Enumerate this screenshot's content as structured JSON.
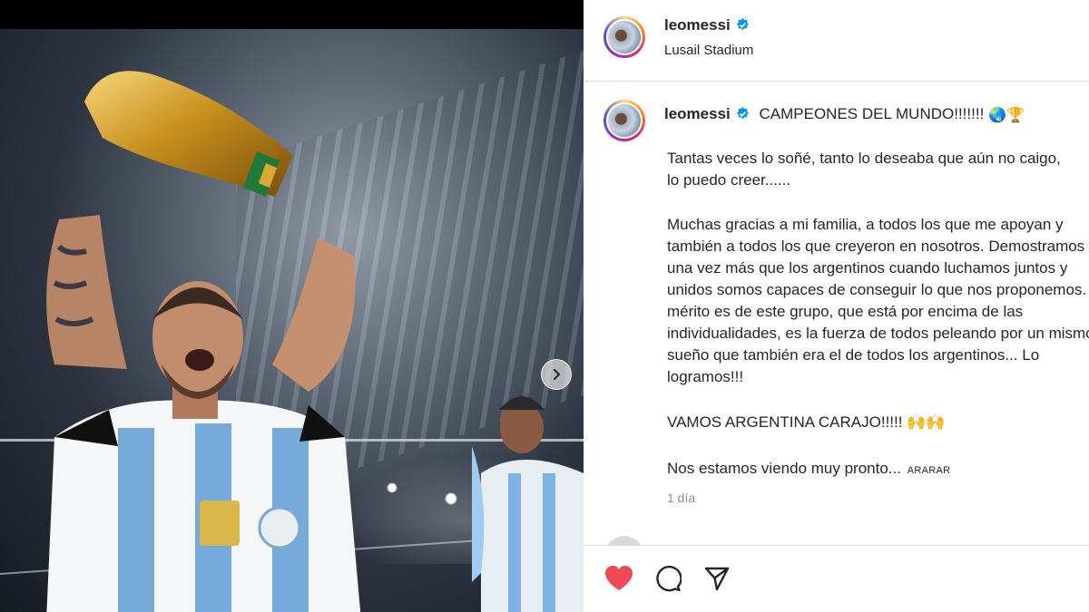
{
  "post": {
    "username": "leomessi",
    "location": "Lusail Stadium",
    "caption_title": "CAMPEONES DEL MUNDO!!!!!!!",
    "caption_emojis": "🌏🏆",
    "caption_lines": [
      "Tantas veces lo soñé, tanto lo deseaba que aún no caigo,",
      "lo puedo creer......",
      "",
      "Muchas gracias a mi familia, a todos los que me apoyan y",
      "también a todos los que creyeron en nosotros. Demostramos",
      "una vez más que los argentinos cuando luchamos juntos y",
      "unidos somos capaces de conseguir lo que nos proponemos. El",
      "mérito es de este grupo, que está por encima de las",
      "individualidades, es la fuerza de todos peleando por un mismo",
      "sueño que también era el de todos los argentinos... Lo",
      "logramos!!!",
      "",
      "VAMOS ARGENTINA CARAJO!!!!! 🙌🙌",
      "",
      "Nos estamos viendo muy pronto..."
    ],
    "more_label": "ARARAR",
    "time_ago": "1 día"
  },
  "icons": {
    "verified": "verified-badge-icon",
    "heart": "heart-icon",
    "comment": "comment-icon",
    "share": "share-icon",
    "next": "chevron-right-icon"
  },
  "colors": {
    "heart": "#ed4956",
    "verified": "#0095f6",
    "text": "#262626",
    "muted": "#8e8e8e"
  }
}
